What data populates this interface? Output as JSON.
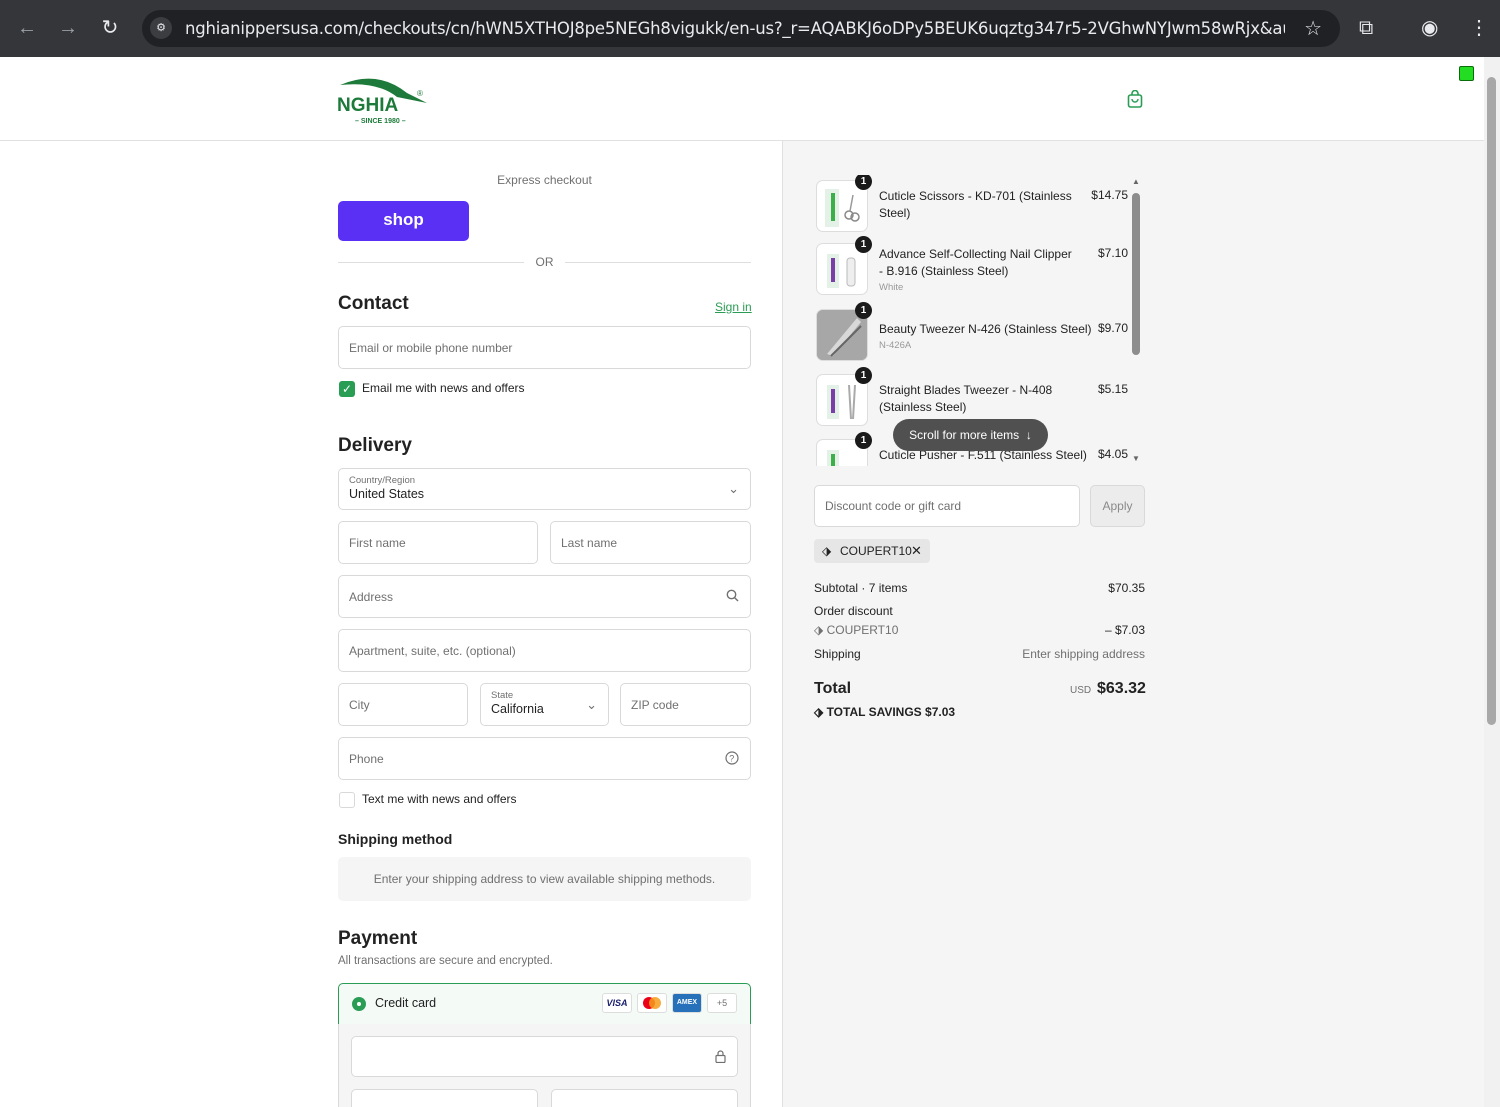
{
  "browser": {
    "url": "nghianippersusa.com/checkouts/cn/hWN5XTHOJ8pe5NEGh8vigukk/en-us?_r=AQABKJ6oDPy5BEUK6uqztg347r5-2VGhwNYJwm58wRjx&auto_redirect...",
    "back_icon": "arrow-left",
    "forward_icon": "arrow-right",
    "reload_icon": "reload"
  },
  "brand": {
    "logo_text": "NGHIA",
    "logo_sub": "– SINCE 1980 –"
  },
  "express": {
    "label": "Express checkout",
    "shop_button": "shop",
    "or": "OR"
  },
  "contact": {
    "title": "Contact",
    "sign_in": "Sign in",
    "email_placeholder": "Email or mobile phone number",
    "email_news_label": "Email me with news and offers",
    "email_news_checked": true
  },
  "delivery": {
    "title": "Delivery",
    "country_label": "Country/Region",
    "country_value": "United States",
    "first_name": "First name",
    "last_name": "Last name",
    "address": "Address",
    "apartment": "Apartment, suite, etc. (optional)",
    "city": "City",
    "state_label": "State",
    "state_value": "California",
    "zip": "ZIP code",
    "phone": "Phone",
    "text_news_label": "Text me with news and offers",
    "text_news_checked": false
  },
  "shipping": {
    "title": "Shipping method",
    "note": "Enter your shipping address to view available shipping methods."
  },
  "payment": {
    "title": "Payment",
    "subtitle": "All transactions are secure and encrypted.",
    "credit_card": "Credit card",
    "cards": [
      "VISA",
      "MC",
      "AMEX",
      "+5"
    ]
  },
  "order": {
    "items": [
      {
        "name": "Cuticle Scissors - KD-701 (Stainless Steel)",
        "variant": "",
        "price": "$14.75",
        "qty": "1"
      },
      {
        "name": "Advance Self-Collecting Nail Clipper - B.916 (Stainless Steel)",
        "variant": "White",
        "price": "$7.10",
        "qty": "1"
      },
      {
        "name": "Beauty Tweezer N-426 (Stainless Steel)",
        "variant": "N-426A",
        "price": "$9.70",
        "qty": "1"
      },
      {
        "name": "Straight Blades Tweezer - N-408 (Stainless Steel)",
        "variant": "",
        "price": "$5.15",
        "qty": "1"
      },
      {
        "name": "Cuticle Pusher - F.511 (Stainless Steel)",
        "variant": "",
        "price": "$4.05",
        "qty": "1"
      }
    ],
    "scroll_more": "Scroll for more items",
    "discount_placeholder": "Discount code or gift card",
    "apply": "Apply",
    "applied_code": "COUPERT10",
    "subtotal_label": "Subtotal · 7 items",
    "subtotal_value": "$70.35",
    "order_discount_label": "Order discount",
    "discount_code": "COUPERT10",
    "discount_value": "– $7.03",
    "shipping_label": "Shipping",
    "shipping_value": "Enter shipping address",
    "total_label": "Total",
    "currency": "USD",
    "total_value": "$63.32",
    "savings": "TOTAL SAVINGS $7.03"
  }
}
